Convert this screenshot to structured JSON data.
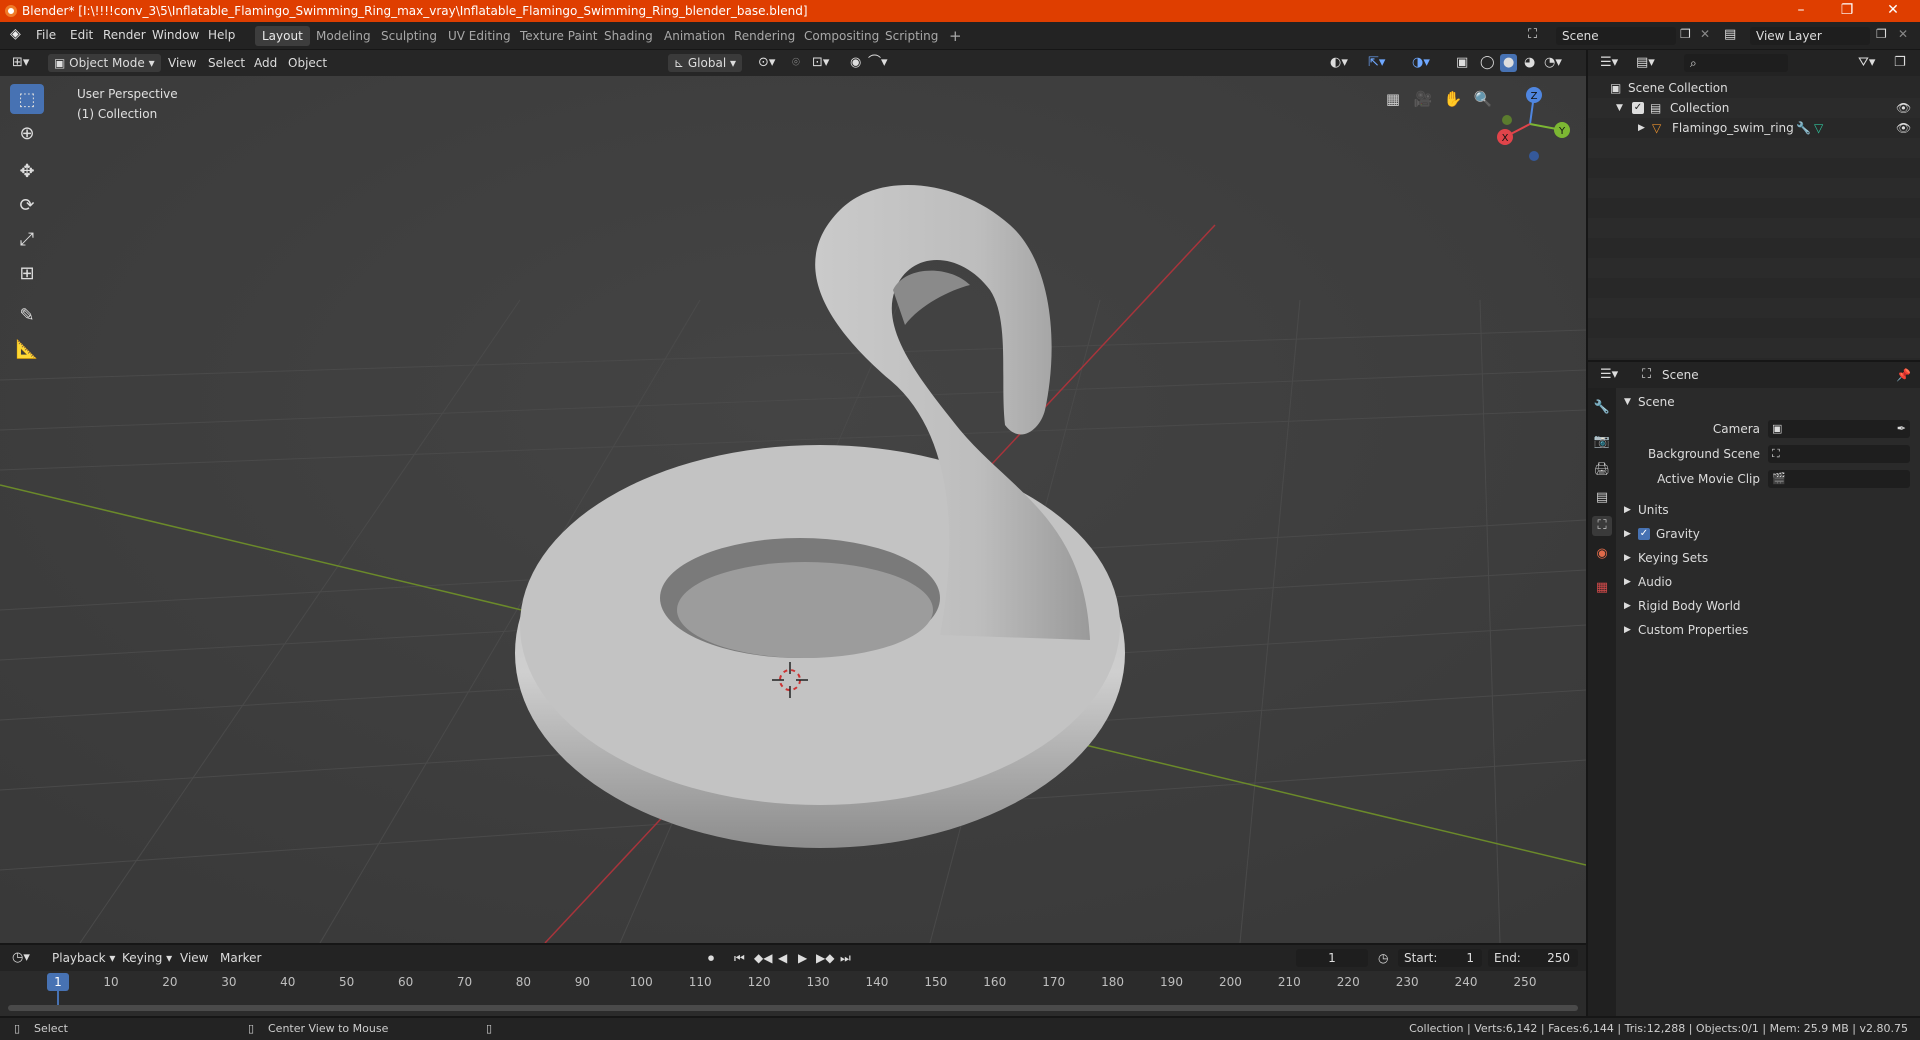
{
  "title_bar": {
    "title": "Blender* [I:\\!!!!conv_3\\5\\Inflatable_Flamingo_Swimming_Ring_max_vray\\Inflatable_Flamingo_Swimming_Ring_blender_base.blend]",
    "minimize": "–",
    "maximize": "❐",
    "close": "✕"
  },
  "menu": {
    "items": [
      "File",
      "Edit",
      "Render",
      "Window",
      "Help"
    ]
  },
  "workspaces": {
    "tabs": [
      "Layout",
      "Modeling",
      "Sculpting",
      "UV Editing",
      "Texture Paint",
      "Shading",
      "Animation",
      "Rendering",
      "Compositing",
      "Scripting"
    ],
    "active": "Layout",
    "add": "+"
  },
  "scene_selector": {
    "value": "Scene"
  },
  "view_layer_selector": {
    "value": "View Layer"
  },
  "viewport_header": {
    "mode": "Object Mode",
    "menus": [
      "View",
      "Select",
      "Add",
      "Object"
    ],
    "transform_orientation": "Global"
  },
  "viewport": {
    "perspective_label": "User Perspective",
    "collection_label": "(1) Collection",
    "gizmo": {
      "x": "X",
      "y": "Y",
      "z": "Z"
    }
  },
  "outliner": {
    "search_placeholder": "",
    "items": [
      {
        "label": "Scene Collection"
      },
      {
        "label": "Collection"
      },
      {
        "label": "Flamingo_swim_ring"
      }
    ]
  },
  "properties": {
    "header_title": "Scene",
    "section": "Scene",
    "fields": [
      {
        "label": "Camera",
        "value": ""
      },
      {
        "label": "Background Scene",
        "value": ""
      },
      {
        "label": "Active Movie Clip",
        "value": ""
      }
    ],
    "panels": [
      "Units",
      "Gravity",
      "Keying Sets",
      "Audio",
      "Rigid Body World",
      "Custom Properties"
    ]
  },
  "timeline": {
    "menus": [
      "Playback",
      "Keying",
      "View",
      "Marker"
    ],
    "current_frame": "1",
    "start_label": "Start:",
    "start": "1",
    "end_label": "End:",
    "end": "250",
    "ticks": [
      "1",
      "10",
      "20",
      "30",
      "40",
      "50",
      "60",
      "70",
      "80",
      "90",
      "100",
      "110",
      "120",
      "130",
      "140",
      "150",
      "160",
      "170",
      "180",
      "190",
      "200",
      "210",
      "220",
      "230",
      "240",
      "250"
    ]
  },
  "status_bar": {
    "left_action": "Select",
    "middle_action": "Center View to Mouse",
    "stats": "Collection | Verts:6,142 | Faces:6,144 | Tris:12,288 | Objects:0/1 | Mem: 25.9 MB | v2.80.75"
  }
}
